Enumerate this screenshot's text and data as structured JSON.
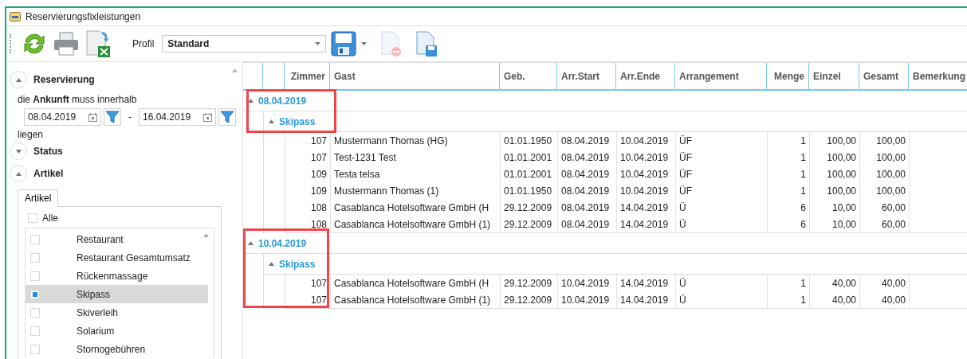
{
  "window": {
    "title": "Reservierungsfixleistungen"
  },
  "toolbar": {
    "profile_label": "Profil",
    "profile_value": "Standard"
  },
  "sidebar": {
    "reservierung": {
      "title": "Reservierung",
      "expanded": true,
      "text": "die **Ankunft** muss innerhalb",
      "date_from": "08.04.2019",
      "separator": "-",
      "date_to": "16.04.2019",
      "suffix": "liegen"
    },
    "status": {
      "title": "Status",
      "expanded": false
    },
    "artikel": {
      "title": "Artikel",
      "expanded": true,
      "tab": {
        "label": "Artikel",
        "selected": true
      },
      "all": {
        "label": "Alle",
        "checked": false
      },
      "items": [
        {
          "label": "Restaurant",
          "checked": false,
          "selected": false
        },
        {
          "label": "Restaurant Gesamtumsatz",
          "checked": false,
          "selected": false
        },
        {
          "label": "Rückenmassage",
          "checked": false,
          "selected": false
        },
        {
          "label": "Skipass",
          "checked": true,
          "selected": true
        },
        {
          "label": "Skiverleih",
          "checked": false,
          "selected": false
        },
        {
          "label": "Solarium",
          "checked": false,
          "selected": false
        },
        {
          "label": "Stornogebühren",
          "checked": false,
          "selected": false
        }
      ]
    }
  },
  "table": {
    "columns": [
      "Zimmer",
      "Gast",
      "Geb.",
      "Arr.Start",
      "Arr.Ende",
      "Arrangement",
      "Menge",
      "Einzel",
      "Gesamt",
      "Bemerkung"
    ],
    "groups": [
      {
        "label": "08.04.2019",
        "expanded": true,
        "highlighted": true,
        "highlight_rows": false,
        "subgroups": [
          {
            "label": "Skipass",
            "expanded": true,
            "rows": [
              [
                "107",
                "Mustermann Thomas (HG)",
                "01.01.1950",
                "08.04.2019",
                "10.04.2019",
                "ÜF",
                "1",
                "100,00",
                "100,00"
              ],
              [
                "107",
                "Test-1231 Test",
                "01.01.2001",
                "08.04.2019",
                "10.04.2019",
                "ÜF",
                "1",
                "100,00",
                "100,00"
              ],
              [
                "109",
                "Testa telsa",
                "01.01.2001",
                "08.04.2019",
                "10.04.2019",
                "ÜF",
                "1",
                "100,00",
                "100,00"
              ],
              [
                "109",
                "Mustermann Thomas (1)",
                "01.01.1950",
                "08.04.2019",
                "10.04.2019",
                "ÜF",
                "1",
                "100,00",
                "100,00"
              ],
              [
                "108",
                "Casablanca Hotelsoftware GmbH (H",
                "29.12.2009",
                "08.04.2019",
                "14.04.2019",
                "Ü",
                "6",
                "10,00",
                "60,00"
              ],
              [
                "108",
                "Casablanca Hotelsoftware GmbH (1)",
                "29.12.2009",
                "08.04.2019",
                "14.04.2019",
                "Ü",
                "6",
                "10,00",
                "60,00"
              ]
            ]
          }
        ]
      },
      {
        "label": "10.04.2019",
        "expanded": true,
        "highlighted": true,
        "highlight_rows": true,
        "subgroups": [
          {
            "label": "Skipass",
            "expanded": true,
            "rows": [
              [
                "107",
                "Casablanca Hotelsoftware GmbH (H",
                "29.12.2009",
                "10.04.2019",
                "14.04.2019",
                "Ü",
                "1",
                "40,00",
                "40,00"
              ],
              [
                "107",
                "Casablanca Hotelsoftware GmbH (1)",
                "29.12.2009",
                "10.04.2019",
                "14.04.2019",
                "Ü",
                "1",
                "40,00",
                "40,00"
              ]
            ]
          }
        ]
      }
    ]
  }
}
